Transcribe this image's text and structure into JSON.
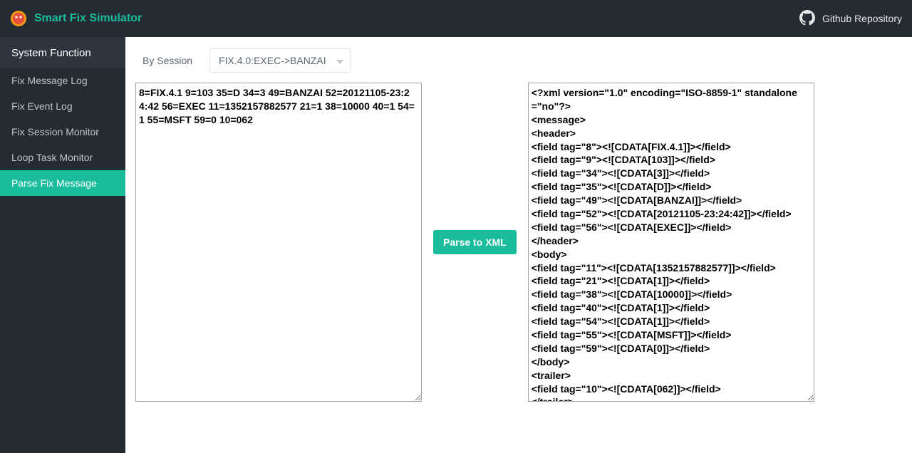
{
  "colors": {
    "accent": "#1abc9c",
    "topbar_bg": "#252b33"
  },
  "header": {
    "app_title": "Smart Fix Simulator",
    "github_label": "Github Repository"
  },
  "sidebar": {
    "group_title": "System Function",
    "items": [
      {
        "label": "Fix Message Log",
        "active": false
      },
      {
        "label": "Fix Event Log",
        "active": false
      },
      {
        "label": "Fix Session Monitor",
        "active": false
      },
      {
        "label": "Loop Task Monitor",
        "active": false
      },
      {
        "label": "Parse Fix Message",
        "active": true
      }
    ]
  },
  "filter": {
    "label": "By Session",
    "selected": "FIX.4.0:EXEC->BANZAI"
  },
  "parse": {
    "button_label": "Parse to XML",
    "input_value": "8=FIX.4.1 9=103 35=D 34=3 49=BANZAI 52=20121105-23:24:42 56=EXEC 11=1352157882577 21=1 38=10000 40=1 54=1 55=MSFT 59=0 10=062",
    "output_value": "<?xml version=\"1.0\" encoding=\"ISO-8859-1\" standalone=\"no\"?>\n<message>\n<header>\n<field tag=\"8\"><![CDATA[FIX.4.1]]></field>\n<field tag=\"9\"><![CDATA[103]]></field>\n<field tag=\"34\"><![CDATA[3]]></field>\n<field tag=\"35\"><![CDATA[D]]></field>\n<field tag=\"49\"><![CDATA[BANZAI]]></field>\n<field tag=\"52\"><![CDATA[20121105-23:24:42]]></field>\n<field tag=\"56\"><![CDATA[EXEC]]></field>\n</header>\n<body>\n<field tag=\"11\"><![CDATA[1352157882577]]></field>\n<field tag=\"21\"><![CDATA[1]]></field>\n<field tag=\"38\"><![CDATA[10000]]></field>\n<field tag=\"40\"><![CDATA[1]]></field>\n<field tag=\"54\"><![CDATA[1]]></field>\n<field tag=\"55\"><![CDATA[MSFT]]></field>\n<field tag=\"59\"><![CDATA[0]]></field>\n</body>\n<trailer>\n<field tag=\"10\"><![CDATA[062]]></field>\n</trailer>\n</message>"
  }
}
